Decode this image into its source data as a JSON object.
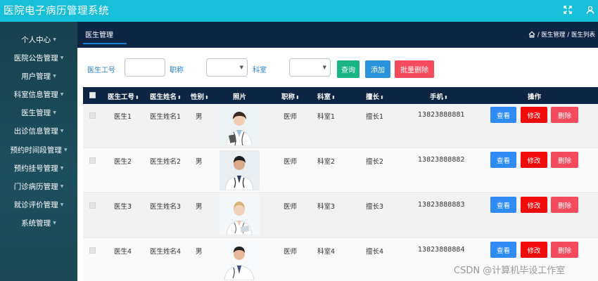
{
  "header": {
    "title": "医院电子病历管理系统",
    "expand_icon": "expand-icon",
    "user_icon": "user-icon",
    "accent": "#17bfd9"
  },
  "sidebar": {
    "items": [
      {
        "label": "个人中心"
      },
      {
        "label": "医院公告管理"
      },
      {
        "label": "用户管理"
      },
      {
        "label": "科室信息管理"
      },
      {
        "label": "医生管理"
      },
      {
        "label": "出诊信息管理"
      },
      {
        "label": "预约时间段管理"
      },
      {
        "label": "预约挂号管理"
      },
      {
        "label": "门诊病历管理"
      },
      {
        "label": "就诊评价管理"
      },
      {
        "label": "系统管理"
      }
    ]
  },
  "tabbar": {
    "active_tab": "医生管理",
    "breadcrumb": [
      "/ 医生管理",
      "/ 医生列表"
    ],
    "home_icon": "home-icon"
  },
  "search": {
    "doctor_no_label": "医生工号",
    "title_label": "职称",
    "dept_label": "科室",
    "doctor_no_value": "",
    "title_value": "",
    "dept_value": "",
    "query_button": "查询",
    "add_button": "添加",
    "batch_delete_button": "批量删除"
  },
  "table": {
    "headers": {
      "no": "医生工号",
      "name": "医生姓名",
      "gender": "性别",
      "photo": "照片",
      "title": "职称",
      "dept": "科室",
      "specialty": "擅长",
      "phone": "手机",
      "ops": "操作"
    },
    "rows": [
      {
        "no": "医生1",
        "name": "医生姓名1",
        "gender": "男",
        "title": "医师",
        "dept": "科室1",
        "specialty": "擅长1",
        "phone": "13823888881",
        "view": "查看",
        "edit": "修改",
        "del": "删除"
      },
      {
        "no": "医生2",
        "name": "医生姓名2",
        "gender": "男",
        "title": "医师",
        "dept": "科室2",
        "specialty": "擅长2",
        "phone": "13823888882",
        "view": "查看",
        "edit": "修改",
        "del": "删除"
      },
      {
        "no": "医生3",
        "name": "医生姓名3",
        "gender": "男",
        "title": "医师",
        "dept": "科室3",
        "specialty": "擅长3",
        "phone": "13823888883",
        "view": "查看",
        "edit": "修改",
        "del": "删除"
      },
      {
        "no": "医生4",
        "name": "医生姓名4",
        "gender": "男",
        "title": "医师",
        "dept": "科室4",
        "specialty": "擅长4",
        "phone": "13823888884",
        "view": "查看",
        "edit": "修改",
        "del": "删除"
      }
    ]
  },
  "watermark": "CSDN @计算机毕设工作室"
}
